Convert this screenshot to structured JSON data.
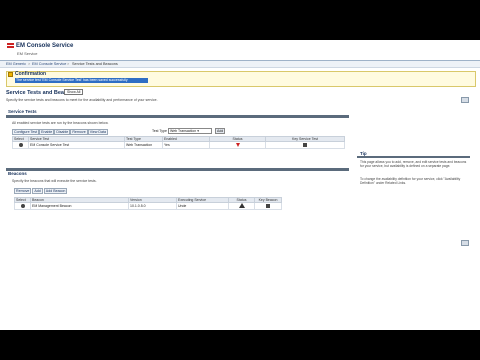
{
  "header": {
    "title": "EM Console Service",
    "subtitle": "EM Service"
  },
  "breadcrumb": [
    "EM Generic",
    "EM Console Service",
    "Service Tests and Beacons"
  ],
  "confirmation": {
    "title": "Confirmation",
    "message": "The service test 'EM Console Service Test' has been saved successfully"
  },
  "page": {
    "title": "Service Tests and Bea",
    "tooltip": "Show All",
    "description": "Specify the service tests and beacons to meet for the availability and performance of your service."
  },
  "service_tests": {
    "title": "Service Tests",
    "note": "All enabled service tests are run by the beacons shown below.",
    "tabs": [
      "Configure Test",
      "Enable",
      "Disable",
      "Remove",
      "View Data"
    ],
    "test_type_label": "Test Type",
    "test_type_value": "Web Transaction",
    "go_label": "Add",
    "columns": [
      "Select",
      "Service Test",
      "Test Type",
      "Enabled",
      "Status",
      "Key Service Test"
    ],
    "rows": [
      {
        "service_test": "EM Console Service Test",
        "test_type": "Web Transaction",
        "enabled": "Yes"
      }
    ]
  },
  "tip": {
    "title": "Tip",
    "paragraphs": [
      "This page allows you to add, remove, and edit service tests and beacons for your service, but availability is defined on a separate page.",
      "To change the availability definition for your service, click \"Availability Definition\" under Related Links."
    ]
  },
  "beacons": {
    "title": "Beacons",
    "description": "Specify the beacons that will execute the service tests.",
    "tabs": [
      "Remove",
      "Add",
      "Add Beacon"
    ],
    "columns": [
      "Select",
      "Beacon",
      "Version",
      "Executing Service",
      "Status",
      "Key Beacon"
    ],
    "rows": [
      {
        "beacon": "EM Management Beacon",
        "version": "10.1.0.5.0",
        "executing": "Unde"
      }
    ]
  },
  "colors": {
    "accent": "#16305a",
    "confirm_bg": "#fffbe0",
    "selection": "#2f6ec4",
    "status_down": "#cc2222"
  }
}
